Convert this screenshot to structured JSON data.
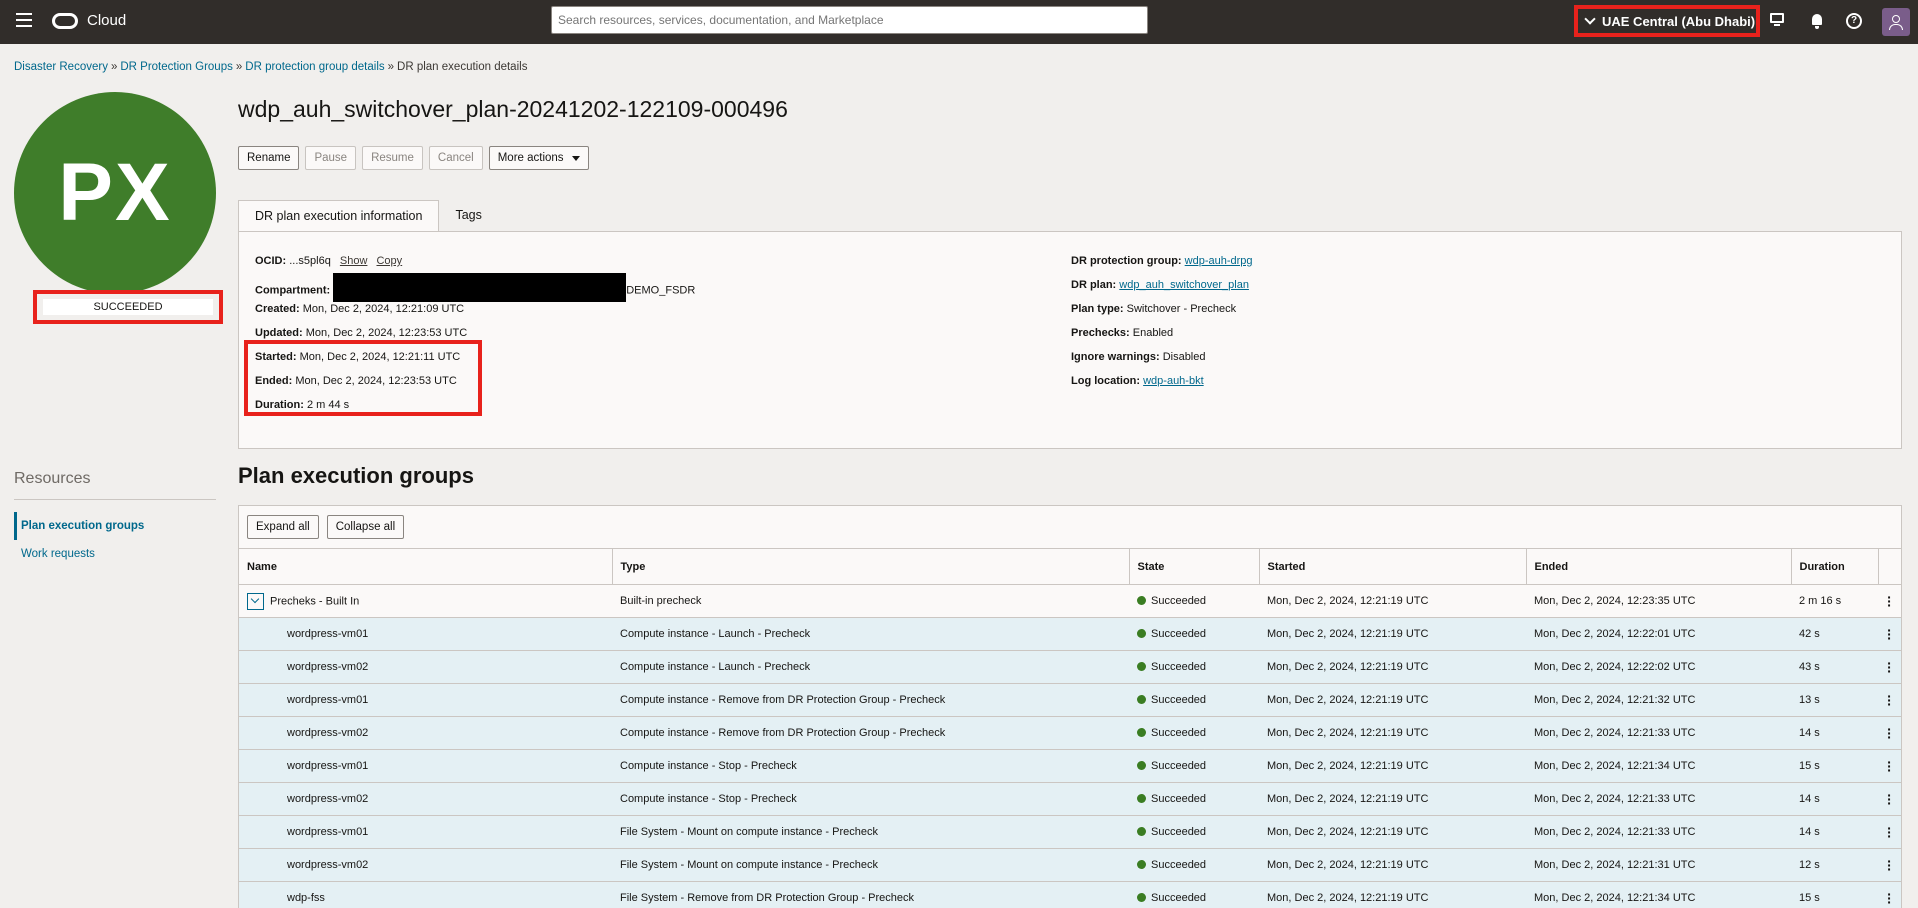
{
  "header": {
    "brand": "Cloud",
    "search_placeholder": "Search resources, services, documentation, and Marketplace",
    "region": "UAE Central (Abu Dhabi)"
  },
  "breadcrumb": {
    "items": [
      "Disaster Recovery",
      "DR Protection Groups",
      "DR protection group details"
    ],
    "current": "DR plan execution details"
  },
  "left": {
    "initials": "PX",
    "status": "SUCCEEDED",
    "resources_title": "Resources",
    "resources": [
      "Plan execution groups",
      "Work requests"
    ]
  },
  "page_title": "wdp_auh_switchover_plan-20241202-122109-000496",
  "actions": {
    "rename": "Rename",
    "pause": "Pause",
    "resume": "Resume",
    "cancel": "Cancel",
    "more": "More actions"
  },
  "tabs": {
    "info": "DR plan execution information",
    "tags": "Tags"
  },
  "info": {
    "ocid_label": "OCID:",
    "ocid_value": "...s5pl6q",
    "show": "Show",
    "copy": "Copy",
    "compartment_label": "Compartment:",
    "compartment_suffix": "DEMO_FSDR",
    "created_label": "Created:",
    "created_value": "Mon, Dec 2, 2024, 12:21:09 UTC",
    "updated_label": "Updated:",
    "updated_value": "Mon, Dec 2, 2024, 12:23:53 UTC",
    "started_label": "Started:",
    "started_value": "Mon, Dec 2, 2024, 12:21:11 UTC",
    "ended_label": "Ended:",
    "ended_value": "Mon, Dec 2, 2024, 12:23:53 UTC",
    "duration_label": "Duration:",
    "duration_value": "2 m 44 s",
    "pg_label": "DR protection group:",
    "pg_value": "wdp-auh-drpg",
    "plan_label": "DR plan:",
    "plan_value": "wdp_auh_switchover_plan",
    "plantype_label": "Plan type:",
    "plantype_value": "Switchover - Precheck",
    "prechecks_label": "Prechecks:",
    "prechecks_value": "Enabled",
    "ignore_label": "Ignore warnings:",
    "ignore_value": "Disabled",
    "log_label": "Log location:",
    "log_value": "wdp-auh-bkt"
  },
  "groups": {
    "title": "Plan execution groups",
    "expand_all": "Expand all",
    "collapse_all": "Collapse all",
    "columns": [
      "Name",
      "Type",
      "State",
      "Started",
      "Ended",
      "Duration"
    ],
    "rows": [
      {
        "name": "Precheks - Built In",
        "type": "Built-in precheck",
        "state": "Succeeded",
        "started": "Mon, Dec 2, 2024, 12:21:19 UTC",
        "ended": "Mon, Dec 2, 2024, 12:23:35 UTC",
        "duration": "2 m 16 s"
      },
      {
        "name": "wordpress-vm01",
        "type": "Compute instance - Launch - Precheck",
        "state": "Succeeded",
        "started": "Mon, Dec 2, 2024, 12:21:19 UTC",
        "ended": "Mon, Dec 2, 2024, 12:22:01 UTC",
        "duration": "42 s"
      },
      {
        "name": "wordpress-vm02",
        "type": "Compute instance - Launch - Precheck",
        "state": "Succeeded",
        "started": "Mon, Dec 2, 2024, 12:21:19 UTC",
        "ended": "Mon, Dec 2, 2024, 12:22:02 UTC",
        "duration": "43 s"
      },
      {
        "name": "wordpress-vm01",
        "type": "Compute instance - Remove from DR Protection Group - Precheck",
        "state": "Succeeded",
        "started": "Mon, Dec 2, 2024, 12:21:19 UTC",
        "ended": "Mon, Dec 2, 2024, 12:21:32 UTC",
        "duration": "13 s"
      },
      {
        "name": "wordpress-vm02",
        "type": "Compute instance - Remove from DR Protection Group - Precheck",
        "state": "Succeeded",
        "started": "Mon, Dec 2, 2024, 12:21:19 UTC",
        "ended": "Mon, Dec 2, 2024, 12:21:33 UTC",
        "duration": "14 s"
      },
      {
        "name": "wordpress-vm01",
        "type": "Compute instance - Stop - Precheck",
        "state": "Succeeded",
        "started": "Mon, Dec 2, 2024, 12:21:19 UTC",
        "ended": "Mon, Dec 2, 2024, 12:21:34 UTC",
        "duration": "15 s"
      },
      {
        "name": "wordpress-vm02",
        "type": "Compute instance - Stop - Precheck",
        "state": "Succeeded",
        "started": "Mon, Dec 2, 2024, 12:21:19 UTC",
        "ended": "Mon, Dec 2, 2024, 12:21:33 UTC",
        "duration": "14 s"
      },
      {
        "name": "wordpress-vm01",
        "type": "File System - Mount on compute instance - Precheck",
        "state": "Succeeded",
        "started": "Mon, Dec 2, 2024, 12:21:19 UTC",
        "ended": "Mon, Dec 2, 2024, 12:21:33 UTC",
        "duration": "14 s"
      },
      {
        "name": "wordpress-vm02",
        "type": "File System - Mount on compute instance - Precheck",
        "state": "Succeeded",
        "started": "Mon, Dec 2, 2024, 12:21:19 UTC",
        "ended": "Mon, Dec 2, 2024, 12:21:31 UTC",
        "duration": "12 s"
      },
      {
        "name": "wdp-fss",
        "type": "File System - Remove from DR Protection Group - Precheck",
        "state": "Succeeded",
        "started": "Mon, Dec 2, 2024, 12:21:19 UTC",
        "ended": "Mon, Dec 2, 2024, 12:21:34 UTC",
        "duration": "15 s"
      }
    ]
  },
  "colors": {
    "header_bg": "#312d2a",
    "highlight": "#e8221c",
    "success": "#3a7d22",
    "link": "#00688c",
    "avatar_bg": "#3f7d2a"
  }
}
